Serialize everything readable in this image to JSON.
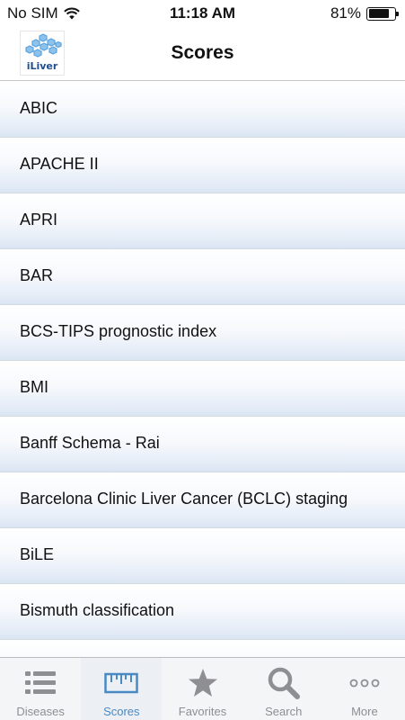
{
  "status_bar": {
    "carrier": "No SIM",
    "time": "11:18 AM",
    "battery_percent_label": "81%",
    "battery_level": 0.81,
    "icons": [
      "wifi-icon",
      "battery-icon"
    ]
  },
  "nav": {
    "title": "Scores",
    "logo_text": "iLiver",
    "logo_icon": "liver-cells-logo-icon"
  },
  "list": {
    "items": [
      {
        "label": "ABIC"
      },
      {
        "label": "APACHE II"
      },
      {
        "label": "APRI"
      },
      {
        "label": "BAR"
      },
      {
        "label": "BCS-TIPS prognostic index"
      },
      {
        "label": "BMI"
      },
      {
        "label": "Banff Schema - Rai"
      },
      {
        "label": "Barcelona Clinic Liver Cancer (BCLC) staging"
      },
      {
        "label": "BiLE"
      },
      {
        "label": "Bismuth classification"
      },
      {
        "label": ""
      }
    ]
  },
  "tabs": [
    {
      "label": "Diseases",
      "icon": "list-icon",
      "active": false
    },
    {
      "label": "Scores",
      "icon": "ruler-icon",
      "active": true
    },
    {
      "label": "Favorites",
      "icon": "star-icon",
      "active": false
    },
    {
      "label": "Search",
      "icon": "magnifier-icon",
      "active": false
    },
    {
      "label": "More",
      "icon": "more-dots-icon",
      "active": false
    }
  ],
  "colors": {
    "active_tab": "#4a8ac4",
    "inactive_tab": "#8e8e93",
    "row_gradient_bottom": "#dae5f2",
    "logo_blue": "#5aa2de"
  }
}
